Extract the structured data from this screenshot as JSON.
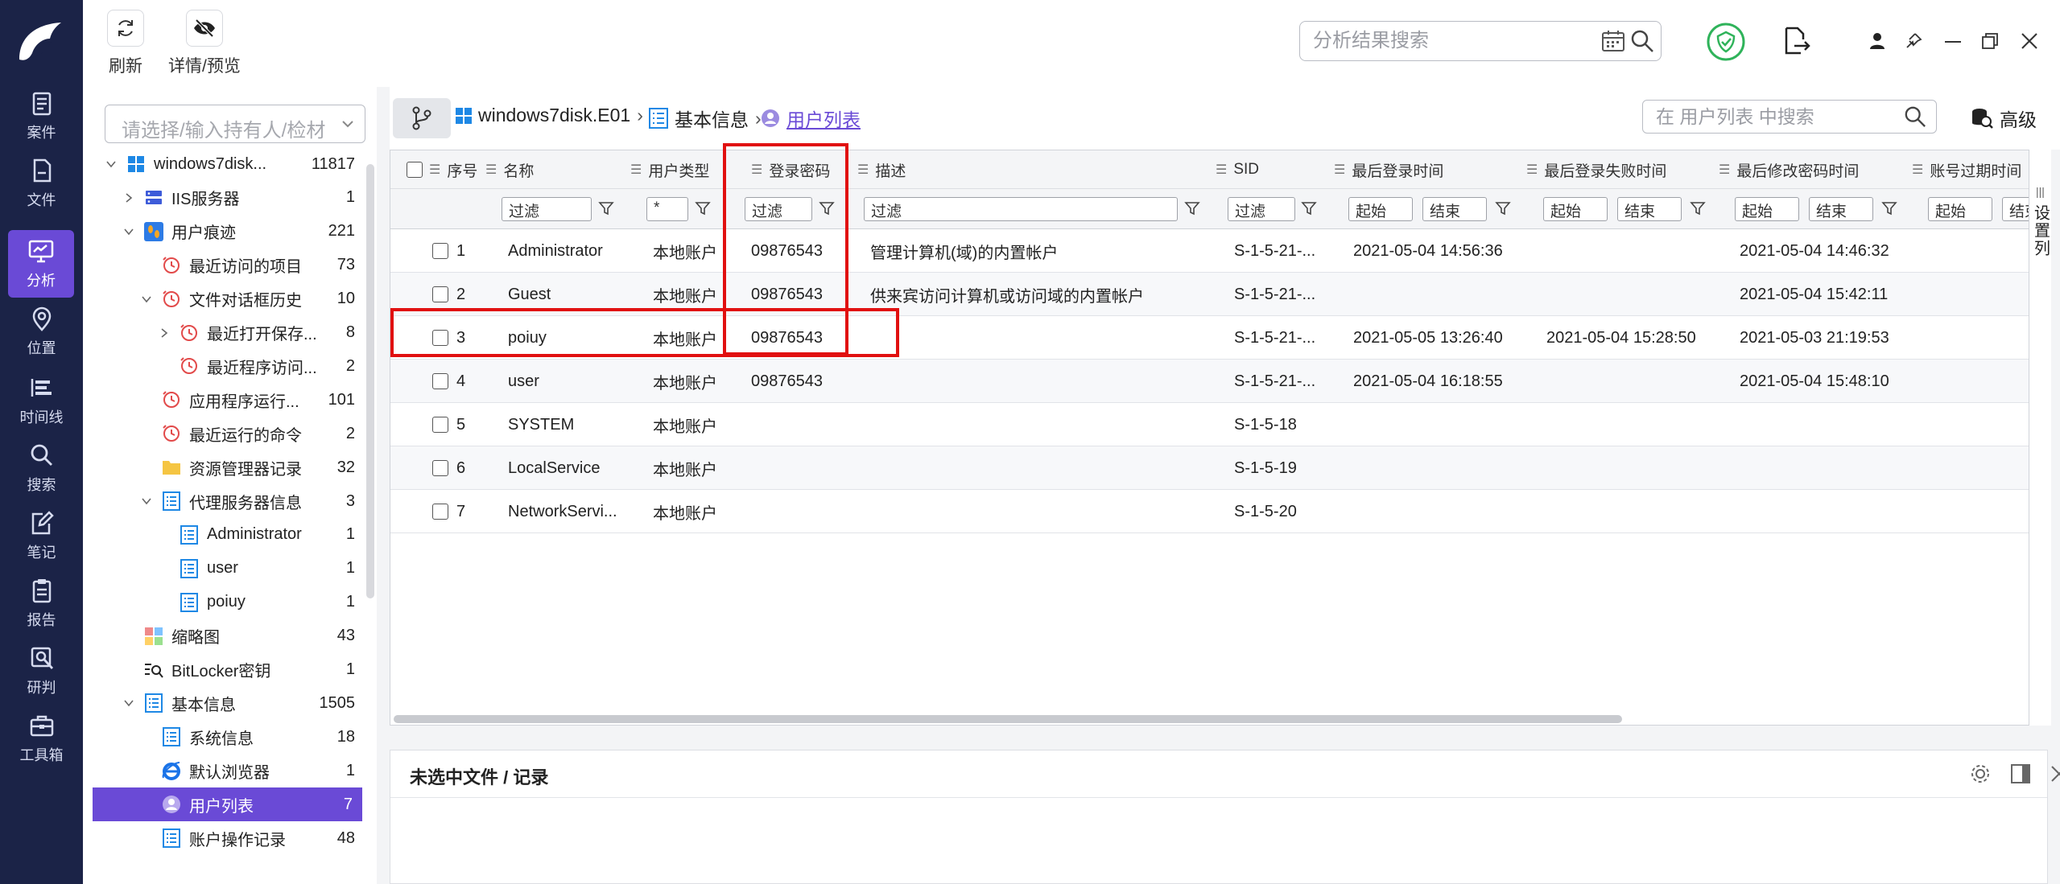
{
  "toolbar": {
    "refresh_label": "刷新",
    "detail_label": "详情/预览",
    "search_placeholder": "分析结果搜索"
  },
  "rail": [
    {
      "label": "案件",
      "icon": "case-icon"
    },
    {
      "label": "文件",
      "icon": "file-icon"
    },
    {
      "label": "分析",
      "icon": "analysis-icon",
      "active": true
    },
    {
      "label": "位置",
      "icon": "location-icon"
    },
    {
      "label": "时间线",
      "icon": "timeline-icon"
    },
    {
      "label": "搜索",
      "icon": "search-icon"
    },
    {
      "label": "笔记",
      "icon": "note-icon"
    },
    {
      "label": "报告",
      "icon": "report-icon"
    },
    {
      "label": "研判",
      "icon": "judge-icon"
    },
    {
      "label": "工具箱",
      "icon": "toolbox-icon"
    }
  ],
  "holder_placeholder": "请选择/输入持有人/检材",
  "tree": [
    {
      "label": "windows7disk...",
      "count": "11817",
      "icon": "windows-icon"
    },
    {
      "label": "IIS服务器",
      "count": "1",
      "icon": "server-icon"
    },
    {
      "label": "用户痕迹",
      "count": "221",
      "icon": "footprint-icon"
    },
    {
      "label": "最近访问的项目",
      "count": "73",
      "icon": "clock-icon"
    },
    {
      "label": "文件对话框历史",
      "count": "10",
      "icon": "clock-icon"
    },
    {
      "label": "最近打开保存...",
      "count": "8",
      "icon": "clock-icon"
    },
    {
      "label": "最近程序访问...",
      "count": "2",
      "icon": "clock-icon"
    },
    {
      "label": "应用程序运行...",
      "count": "101",
      "icon": "clock-icon"
    },
    {
      "label": "最近运行的命令",
      "count": "2",
      "icon": "clock-icon"
    },
    {
      "label": "资源管理器记录",
      "count": "32",
      "icon": "folder-icon"
    },
    {
      "label": "代理服务器信息",
      "count": "3",
      "icon": "list-icon"
    },
    {
      "label": "Administrator",
      "count": "1",
      "icon": "list-icon"
    },
    {
      "label": "user",
      "count": "1",
      "icon": "list-icon"
    },
    {
      "label": "poiuy",
      "count": "1",
      "icon": "list-icon"
    },
    {
      "label": "缩略图",
      "count": "43",
      "icon": "thumbnail-icon"
    },
    {
      "label": "BitLocker密钥",
      "count": "1",
      "icon": "key-search-icon"
    },
    {
      "label": "基本信息",
      "count": "1505",
      "icon": "list-icon"
    },
    {
      "label": "系统信息",
      "count": "18",
      "icon": "list-icon"
    },
    {
      "label": "默认浏览器",
      "count": "1",
      "icon": "ie-icon"
    },
    {
      "label": "用户列表",
      "count": "7",
      "icon": "user-icon"
    },
    {
      "label": "账户操作记录",
      "count": "48",
      "icon": "list-icon"
    }
  ],
  "breadcrumb": {
    "disk": "windows7disk.E01",
    "section": "基本信息",
    "current": "用户列表",
    "search_placeholder": "在 用户列表 中搜索",
    "advanced": "高级"
  },
  "grid": {
    "headers": [
      "序号",
      "名称",
      "用户类型",
      "登录密码",
      "描述",
      "SID",
      "最后登录时间",
      "最后登录失败时间",
      "最后修改密码时间",
      "账号过期时间"
    ],
    "filter": {
      "text": "过滤",
      "star": "*",
      "start": "起始",
      "end": "结束"
    },
    "rows": [
      {
        "no": "1",
        "name": "Administrator",
        "type": "本地账户",
        "pwd": "09876543",
        "desc": "管理计算机(域)的内置帐户",
        "sid": "S-1-5-21-...",
        "last_login": "2021-05-04 14:56:36",
        "last_fail": "",
        "pwd_changed": "2021-05-04 14:46:32"
      },
      {
        "no": "2",
        "name": "Guest",
        "type": "本地账户",
        "pwd": "09876543",
        "desc": "供来宾访问计算机或访问域的内置帐户",
        "sid": "S-1-5-21-...",
        "last_login": "",
        "last_fail": "",
        "pwd_changed": "2021-05-04 15:42:11"
      },
      {
        "no": "3",
        "name": "poiuy",
        "type": "本地账户",
        "pwd": "09876543",
        "desc": "",
        "sid": "S-1-5-21-...",
        "last_login": "2021-05-05 13:26:40",
        "last_fail": "2021-05-04 15:28:50",
        "pwd_changed": "2021-05-03 21:19:53"
      },
      {
        "no": "4",
        "name": "user",
        "type": "本地账户",
        "pwd": "09876543",
        "desc": "",
        "sid": "S-1-5-21-...",
        "last_login": "2021-05-04 16:18:55",
        "last_fail": "",
        "pwd_changed": "2021-05-04 15:48:10"
      },
      {
        "no": "5",
        "name": "SYSTEM",
        "type": "本地账户",
        "pwd": "",
        "desc": "",
        "sid": "S-1-5-18",
        "last_login": "",
        "last_fail": "",
        "pwd_changed": ""
      },
      {
        "no": "6",
        "name": "LocalService",
        "type": "本地账户",
        "pwd": "",
        "desc": "",
        "sid": "S-1-5-19",
        "last_login": "",
        "last_fail": "",
        "pwd_changed": ""
      },
      {
        "no": "7",
        "name": "NetworkServi...",
        "type": "本地账户",
        "pwd": "",
        "desc": "",
        "sid": "S-1-5-20",
        "last_login": "",
        "last_fail": "",
        "pwd_changed": ""
      }
    ],
    "set_columns": "设置列"
  },
  "detail": {
    "title": "未选中文件 / 记录"
  },
  "colors": {
    "rail_bg": "#1b2347",
    "accent": "#6a4ad6",
    "highlight": "#e11010",
    "status_green": "#2fb35a"
  }
}
